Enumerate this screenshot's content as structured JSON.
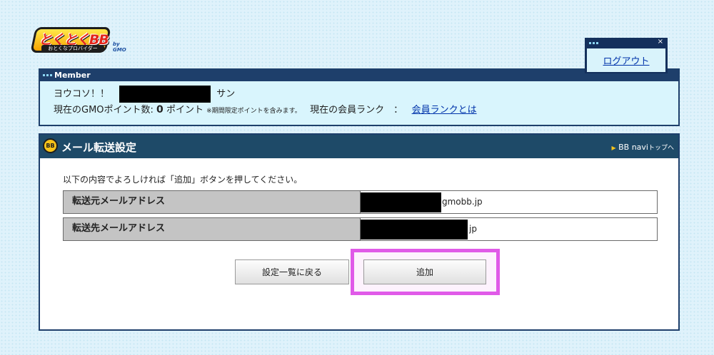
{
  "logo": {
    "brand": "とくとくBB",
    "tagline": "おとくなプロバイダー",
    "gmo": "by GMO"
  },
  "logout": {
    "label": "ログアウト"
  },
  "member": {
    "header": "Member",
    "greeting": "ヨウコソ！！",
    "greeting_suffix": "サン",
    "points_label": "現在のGMOポイント数:",
    "points_value": "0",
    "points_unit": "ポイント",
    "points_note": "※期間限定ポイントを含みます。",
    "rank_label": "現在の会員ランク　：",
    "rank_link": "会員ランクとは"
  },
  "main": {
    "title": "メール転送設定",
    "nav_link": "BB navi",
    "nav_link_suffix": "トップへ",
    "instruction": "以下の内容でよろしければ「追加」ボタンを押してください。",
    "rows": [
      {
        "label": "転送元メールアドレス",
        "value_suffix": "gmobb.jp"
      },
      {
        "label": "転送先メールアドレス",
        "value_suffix": "jp"
      }
    ],
    "back_button": "設定一覧に戻る",
    "add_button": "追加"
  },
  "colors": {
    "highlight": "#e05ae8",
    "panel_border": "#1e3f6b",
    "link": "#0033aa"
  }
}
